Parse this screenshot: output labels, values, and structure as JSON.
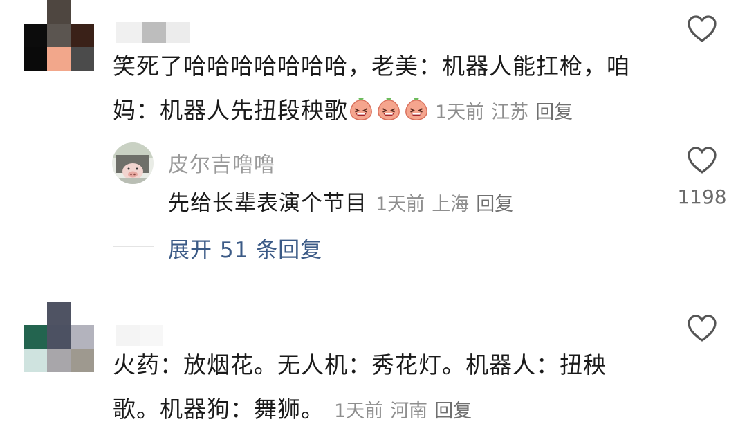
{
  "comments": [
    {
      "text_line1": "笑死了哈哈哈哈哈哈哈，老美：机器人能扛枪，咱",
      "text_line2": "妈：机器人先扭段秧歌",
      "emojis": [
        "laugh-emoji",
        "laugh-emoji",
        "laugh-emoji"
      ],
      "time": "1天前",
      "location": "江苏",
      "reply_label": "回复",
      "likes": "",
      "replies": [
        {
          "username": "皮尔吉噜噜",
          "text": "先给长辈表演个节目",
          "time": "1天前",
          "location": "上海",
          "reply_label": "回复"
        }
      ],
      "reply_like_count": "1198",
      "expand_label": "展开 51 条回复"
    },
    {
      "text_line1": "火药：放烟花。无人机：秀花灯。机器人：扭秧",
      "text_line2": "歌。机器狗：舞狮。",
      "time": "1天前",
      "location": "河南",
      "reply_label": "回复"
    }
  ],
  "colors": {
    "text": "#1a1a1a",
    "meta": "#8e8e8e",
    "link": "#3b5a86",
    "heart_outline": "#555555"
  }
}
